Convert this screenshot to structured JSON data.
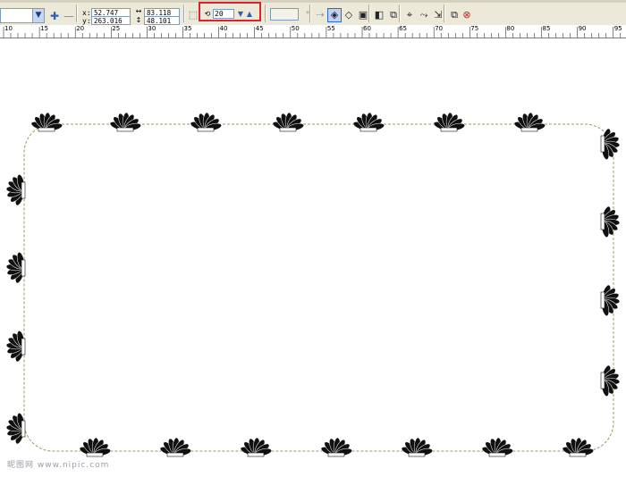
{
  "property_bar": {
    "x_label": "x:",
    "y_label": "y:",
    "x_value": "52.747 mm",
    "y_value": "263.016 mm",
    "width_value": "83.118 mm",
    "height_value": "48.101 mm",
    "step_count": "20",
    "icons": {
      "combo": "chevron-down-icon",
      "add": "plus-icon",
      "remove": "minus-icon",
      "width": "width-icon",
      "height": "height-icon",
      "steps": "steps-icon"
    }
  },
  "ruler": {
    "ticks": [
      "10",
      "15",
      "20",
      "25",
      "30",
      "35",
      "40",
      "45",
      "50",
      "55",
      "60",
      "65",
      "70",
      "75",
      "80",
      "85",
      "90",
      "95"
    ]
  },
  "watermark": {
    "text": "昵图网 www.nipic.com"
  },
  "colors": {
    "toolbar_bg": "#ece9d8",
    "highlight": "#e0202a",
    "path": "#9a9a60",
    "fan": "#111111"
  }
}
